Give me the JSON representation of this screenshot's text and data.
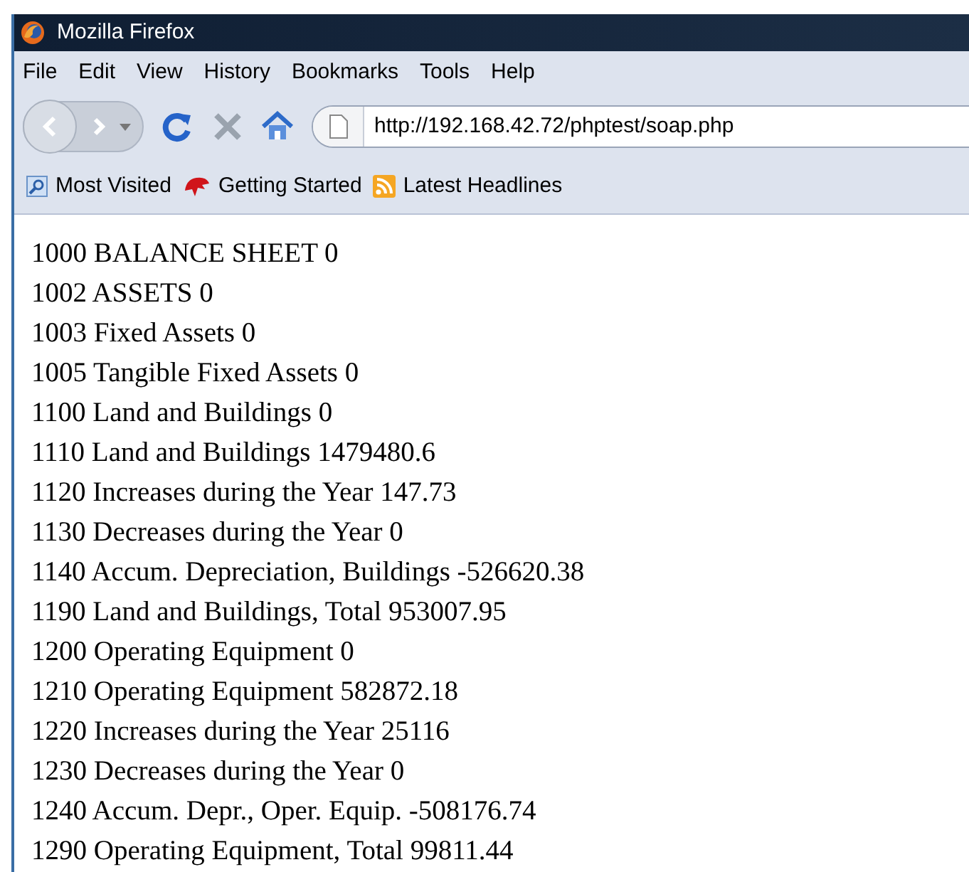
{
  "window": {
    "title": "Mozilla Firefox"
  },
  "menu": [
    "File",
    "Edit",
    "View",
    "History",
    "Bookmarks",
    "Tools",
    "Help"
  ],
  "address_bar": {
    "value": "http://192.168.42.72/phptest/soap.php"
  },
  "bookmarks": [
    {
      "label": "Most Visited",
      "kind": "search"
    },
    {
      "label": "Getting Started",
      "kind": "dino"
    },
    {
      "label": "Latest Headlines",
      "kind": "feed"
    }
  ],
  "content_lines": [
    "1000 BALANCE SHEET 0",
    "1002 ASSETS 0",
    "1003 Fixed Assets 0",
    "1005 Tangible Fixed Assets 0",
    "1100 Land and Buildings 0",
    "1110 Land and Buildings 1479480.6",
    "1120 Increases during the Year 147.73",
    "1130 Decreases during the Year 0",
    "1140 Accum. Depreciation, Buildings -526620.38",
    "1190 Land and Buildings, Total 953007.95",
    "1200 Operating Equipment 0",
    "1210 Operating Equipment 582872.18",
    "1220 Increases during the Year 25116",
    "1230 Decreases during the Year 0",
    "1240 Accum. Depr., Oper. Equip. -508176.74",
    "1290 Operating Equipment, Total 99811.44"
  ]
}
